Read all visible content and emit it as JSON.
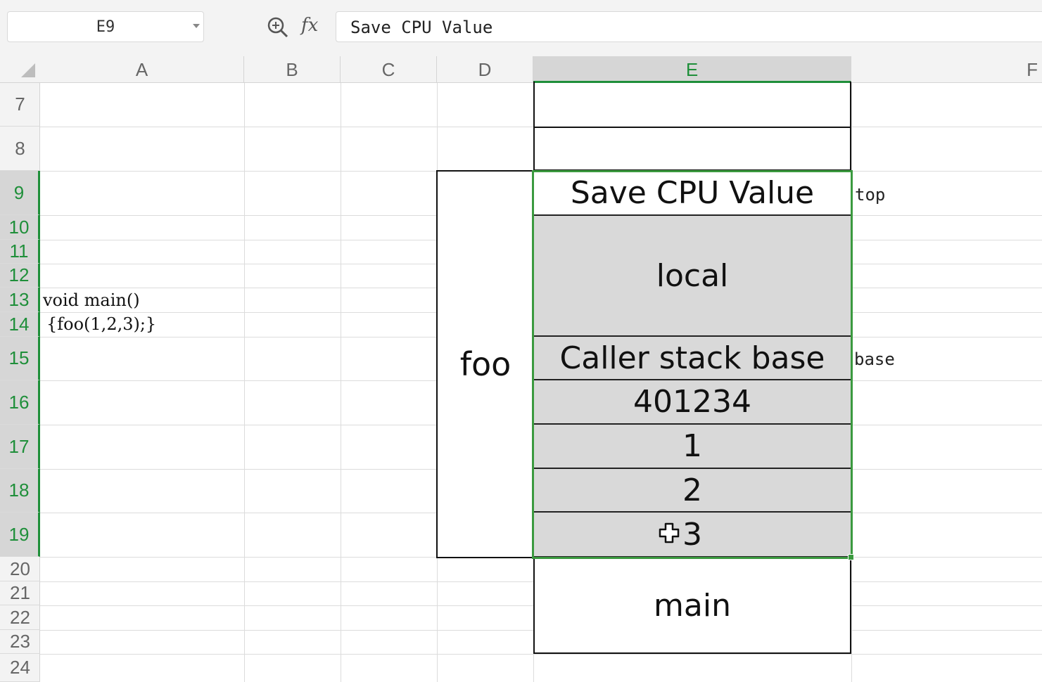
{
  "formula_bar": {
    "name_box": "E9",
    "fx_label": "fx",
    "formula": "Save CPU Value"
  },
  "columns": [
    "A",
    "B",
    "C",
    "D",
    "E",
    "F"
  ],
  "selected_column": "E",
  "rows": [
    "7",
    "8",
    "9",
    "10",
    "11",
    "12",
    "13",
    "14",
    "15",
    "16",
    "17",
    "18",
    "19",
    "20",
    "21",
    "22",
    "23",
    "24"
  ],
  "code": {
    "line1": "void main()",
    "line2": "{foo(1,2,3);}"
  },
  "frame_labels": {
    "foo": "foo",
    "main": "main"
  },
  "stack": {
    "save_cpu": "Save CPU Value",
    "local": "local",
    "caller_base": "Caller stack base",
    "return_addr": "401234",
    "arg1": "1",
    "arg2": "2",
    "arg3": "3"
  },
  "pointers": {
    "top": "top",
    "base": "base"
  },
  "colors": {
    "selection": "#3b9a3f",
    "stack_fill": "#d9d9d9"
  }
}
